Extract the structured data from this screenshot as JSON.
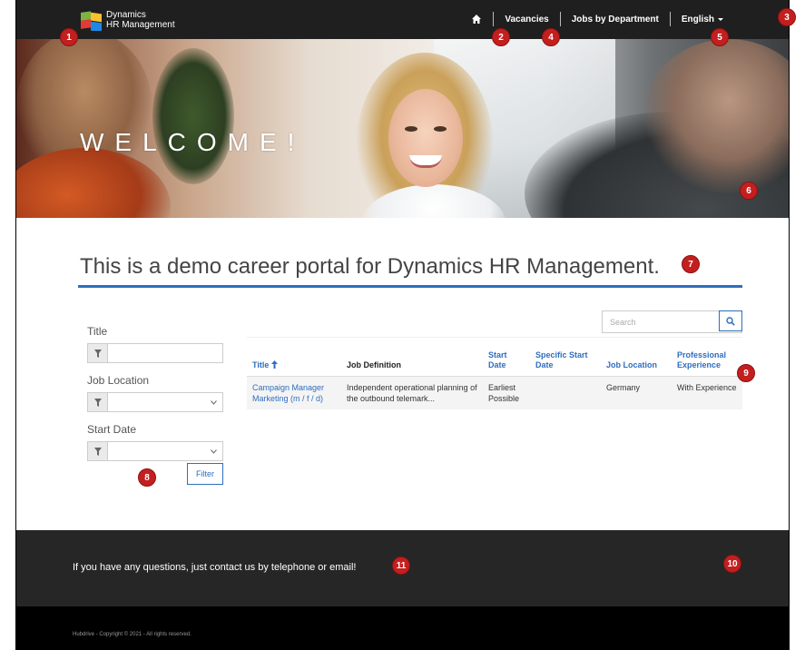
{
  "header": {
    "logo_line1": "Dynamics",
    "logo_line2": "HR Management",
    "nav": {
      "vacancies": "Vacancies",
      "jobs_by_department": "Jobs by Department",
      "language": "English"
    }
  },
  "hero": {
    "welcome": "WELCOME!"
  },
  "tagline": "This is a demo career portal for Dynamics HR Management.",
  "filter": {
    "title_label": "Title",
    "location_label": "Job Location",
    "start_label": "Start Date",
    "filter_button": "Filter"
  },
  "search": {
    "placeholder": "Search"
  },
  "table": {
    "headers": {
      "title": "Title",
      "definition": "Job Definition",
      "start_date": "Start Date",
      "specific_start": "Specific Start Date",
      "location": "Job Location",
      "experience": "Professional Experience"
    },
    "rows": [
      {
        "title": "Campaign Manager Marketing (m / f / d)",
        "definition": "Independent operational planning of the outbound telemark...",
        "start_date": "Earliest Possible",
        "specific_start": "",
        "location": "Germany",
        "experience": "With Experience"
      }
    ]
  },
  "footer": {
    "contact": "If you have any questions, just contact us by telephone or email!",
    "copyright": "Hubdrive - Copyright © 2021 - All rights reserved."
  },
  "badges": [
    "1",
    "2",
    "3",
    "4",
    "5",
    "6",
    "7",
    "8",
    "9",
    "10",
    "11"
  ],
  "colors": {
    "accent": "#2e6ebf",
    "badge": "#c41f1f",
    "header_bg": "#1f1f1f",
    "footer_bg": "#262626"
  }
}
